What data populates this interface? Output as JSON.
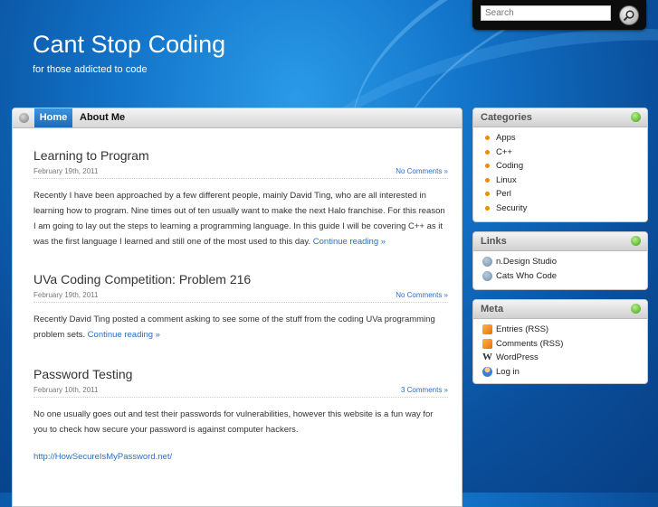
{
  "search": {
    "placeholder": "Search"
  },
  "site": {
    "title": "Cant Stop Coding",
    "tagline": "for those addicted to code"
  },
  "nav": {
    "home": "Home",
    "about": "About Me"
  },
  "posts": [
    {
      "title": "Learning to Program",
      "date": "February 19th, 2011",
      "comments": "No Comments »",
      "body": "Recently I have been approached by a few different people, mainly David Ting, who are all interested in learning how to program. Nine times out of ten usually want to make the next Halo franchise. For this reason I am going to lay out the steps to learning a programming language. In this guide I will be covering C++ as it was the first language I learned and still one of the most used to this day.",
      "more": "Continue reading »"
    },
    {
      "title": "UVa Coding Competition: Problem 216",
      "date": "February 19th, 2011",
      "comments": "No Comments »",
      "body": "Recently David Ting posted a comment asking to see some of the stuff from the coding UVa programming problem sets.",
      "more": "Continue reading »"
    },
    {
      "title": "Password Testing",
      "date": "February 10th, 2011",
      "comments": "3 Comments »",
      "body": "No one usually goes out and test their passwords for vulnerabilities, however this website is a fun way for you to check how secure your password is against computer hackers.",
      "link": "http://HowSecureIsMyPassword.net/"
    }
  ],
  "sidebar": {
    "categories": {
      "title": "Categories",
      "items": [
        "Apps",
        "C++",
        "Coding",
        "Linux",
        "Perl",
        "Security"
      ]
    },
    "links": {
      "title": "Links",
      "items": [
        "n.Design Studio",
        "Cats Who Code"
      ]
    },
    "meta": {
      "title": "Meta",
      "items": [
        "Entries (RSS)",
        "Comments (RSS)",
        "WordPress",
        "Log in"
      ]
    }
  }
}
